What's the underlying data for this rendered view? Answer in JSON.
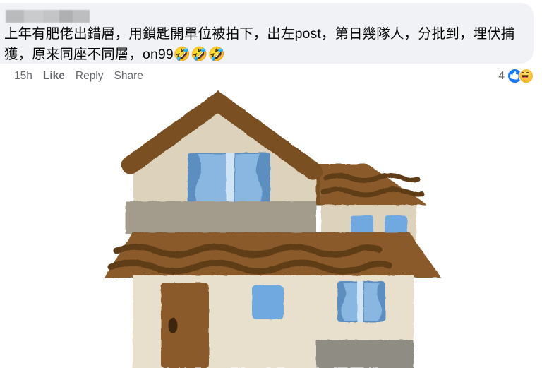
{
  "post": {
    "author_redacted": true,
    "comment_text": "上年有肥佬出錯層，用鎖匙開單位被拍下，出左post，第日幾隊人，分批到，埋伏捕獲，原来同座不同層，on99🤣🤣🤣",
    "timestamp": "15h",
    "actions": {
      "like_label": "Like",
      "reply_label": "Reply",
      "share_label": "Share"
    },
    "reactions": {
      "count": "4",
      "icons": [
        "like-icon",
        "haha-icon"
      ]
    },
    "bubble_color": "#f0f2f5",
    "text_color": "#050505",
    "meta_color": "#65676b",
    "like_blue": "#1877f2",
    "haha_yellow": "#f7b125"
  },
  "illustration": {
    "name": "two-story-house-illustration",
    "alt": "Illustration of a two-story house with brown roofs, beige walls, blue windows and a brown front door",
    "colors": {
      "roof_brown": "#7a4f23",
      "roof_brown_dark": "#5e3c19",
      "tile_roof": "#8a5a2b",
      "wall_beige": "#ddd3bd",
      "wall_beige_light": "#e8e0cd",
      "balcony_grey": "#a39c8d",
      "foundation_grey": "#8f8d83",
      "window_blue": "#6fa9e0",
      "window_blue_dark": "#5b8fc0",
      "curtain_blue": "#8ab7e2",
      "curtain_light": "#cfe4f5",
      "door_brown": "#8a5a2b",
      "door_handle": "#3d2610"
    },
    "parts": [
      "gable-roof",
      "upper-wall",
      "upper-window-with-curtains",
      "balcony",
      "right-upper-roof",
      "right-upper-wall",
      "right-small-window-left",
      "right-small-window-right",
      "main-tiled-roof",
      "lower-wall",
      "front-door",
      "door-handle",
      "lower-window-plain",
      "lower-window-with-curtains",
      "foundation"
    ]
  }
}
